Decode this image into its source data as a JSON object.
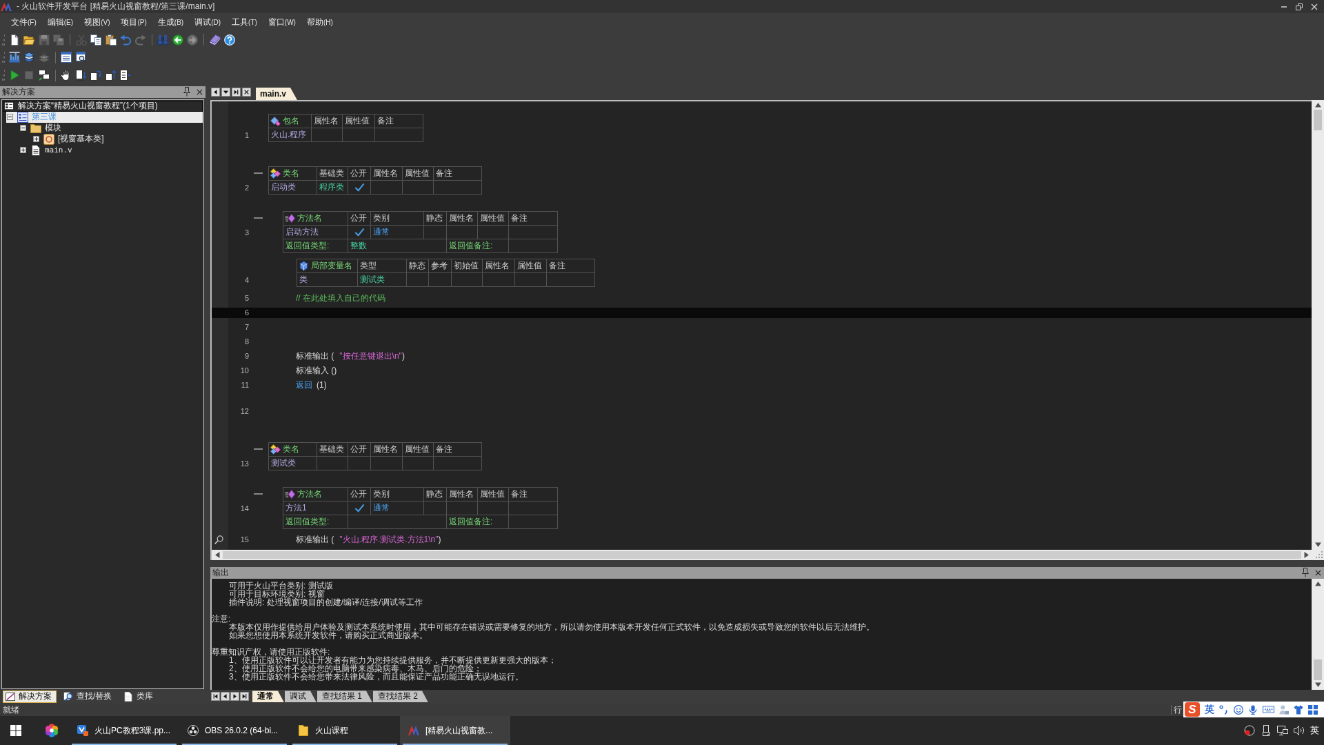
{
  "window": {
    "title": "- 火山软件开发平台 [精易火山视窗教程/第三课/main.v]"
  },
  "menu": [
    {
      "label": "文件",
      "key": "(F)"
    },
    {
      "label": "编辑",
      "key": "(E)"
    },
    {
      "label": "视图",
      "key": "(V)"
    },
    {
      "label": "项目",
      "key": "(P)"
    },
    {
      "label": "生成",
      "key": "(B)"
    },
    {
      "label": "调试",
      "key": "(D)"
    },
    {
      "label": "工具",
      "key": "(T)"
    },
    {
      "label": "窗口",
      "key": "(W)"
    },
    {
      "label": "帮助",
      "key": "(H)"
    }
  ],
  "toolbars": [
    {
      "groups": [
        [
          {
            "kind": "new",
            "disabled": false
          },
          {
            "kind": "open",
            "disabled": false
          },
          {
            "kind": "save",
            "disabled": true
          },
          {
            "kind": "save-all",
            "disabled": true
          }
        ],
        [
          {
            "kind": "cut",
            "disabled": true
          },
          {
            "kind": "copy",
            "disabled": false
          },
          {
            "kind": "paste",
            "disabled": false
          },
          {
            "kind": "undo",
            "disabled": false
          },
          {
            "kind": "redo",
            "disabled": true
          }
        ],
        [
          {
            "kind": "find",
            "disabled": false
          },
          {
            "kind": "back",
            "disabled": false
          },
          {
            "kind": "forward",
            "disabled": true
          }
        ],
        [
          {
            "kind": "book",
            "disabled": false
          },
          {
            "kind": "help",
            "disabled": false
          }
        ]
      ]
    },
    {
      "groups": [
        [
          {
            "kind": "build",
            "disabled": false
          },
          {
            "kind": "build-all",
            "disabled": false
          },
          {
            "kind": "clean",
            "disabled": true
          }
        ],
        [
          {
            "kind": "list",
            "disabled": false
          },
          {
            "kind": "preview",
            "disabled": false
          }
        ]
      ]
    },
    {
      "groups": [
        [
          {
            "kind": "run",
            "disabled": false
          },
          {
            "kind": "stop",
            "disabled": true
          },
          {
            "kind": "attach",
            "disabled": false
          }
        ],
        [
          {
            "kind": "hand",
            "disabled": false
          },
          {
            "kind": "step-into",
            "disabled": false
          },
          {
            "kind": "step-over",
            "disabled": false
          },
          {
            "kind": "step-out",
            "disabled": false
          },
          {
            "kind": "run-to",
            "disabled": false
          }
        ]
      ]
    }
  ],
  "solution_panel": {
    "title": "解决方案",
    "root": {
      "label": "解决方案“精易火山视窗教程”(1个项目)",
      "selected": false,
      "children": [
        {
          "label": "第三课",
          "kind": "project",
          "expanded": true,
          "selected": true,
          "children": [
            {
              "label": "模块",
              "kind": "folder",
              "expanded": true,
              "selected": false,
              "children": [
                {
                  "label": "[视窗基本类]",
                  "kind": "class",
                  "expanded": false,
                  "selected": false
                }
              ]
            },
            {
              "label": "main.v",
              "kind": "file",
              "expanded": false,
              "selected": false
            }
          ]
        }
      ]
    },
    "tabs": [
      {
        "label": "解决方案",
        "kind": "solution",
        "selected": true
      },
      {
        "label": "查找/替换",
        "kind": "find",
        "selected": false
      },
      {
        "label": "类库",
        "kind": "library",
        "selected": false
      }
    ]
  },
  "editor": {
    "tabs": [
      {
        "label": "main.v",
        "selected": true
      }
    ],
    "lines": [
      {
        "kind": "package",
        "number": "1",
        "header": [
          "包名",
          "属性名",
          "属性值",
          "备注"
        ],
        "rows": [
          {
            "kind": "main",
            "cells": [
              {
                "kind": "name",
                "text": "火山.程序"
              },
              {
                "kind": "empty"
              },
              {
                "kind": "empty"
              },
              {
                "kind": "empty"
              }
            ]
          }
        ]
      },
      {
        "kind": "class",
        "number": "2",
        "expanded": true,
        "header": [
          "类名",
          "基础类",
          "公开",
          "属性名",
          "属性值",
          "备注"
        ],
        "rows": [
          {
            "kind": "main",
            "cells": [
              {
                "kind": "name",
                "text": "启动类"
              },
              {
                "kind": "type",
                "text": "程序类"
              },
              {
                "kind": "check",
                "checked": true
              },
              {
                "kind": "empty"
              },
              {
                "kind": "empty"
              },
              {
                "kind": "empty"
              }
            ]
          }
        ]
      },
      {
        "kind": "method",
        "number": "3",
        "expanded": true,
        "header": [
          "方法名",
          "公开",
          "类别",
          "静态",
          "属性名",
          "属性值",
          "备注"
        ],
        "rows": [
          {
            "kind": "main",
            "cells": [
              {
                "kind": "name",
                "text": "启动方法"
              },
              {
                "kind": "check",
                "checked": true
              },
              {
                "kind": "keyword",
                "text": "通常"
              },
              {
                "kind": "check",
                "checked": false
              },
              {
                "kind": "empty"
              },
              {
                "kind": "empty"
              },
              {
                "kind": "empty"
              }
            ]
          },
          {
            "kind": "return",
            "cells": [
              {
                "kind": "label",
                "text": "返回值类型:"
              },
              {
                "kind": "type",
                "text": "整数"
              },
              {
                "kind": "label",
                "text": "返回值备注:"
              },
              {
                "kind": "empty"
              }
            ]
          }
        ]
      },
      {
        "kind": "locals",
        "number": "4",
        "header": [
          "局部变量名",
          "类型",
          "静态",
          "参考",
          "初始值",
          "属性名",
          "属性值",
          "备注"
        ],
        "rows": [
          {
            "kind": "main",
            "cells": [
              {
                "kind": "name",
                "text": "类"
              },
              {
                "kind": "type",
                "text": "测试类"
              },
              {
                "kind": "check",
                "checked": false
              },
              {
                "kind": "check",
                "checked": false
              },
              {
                "kind": "empty"
              },
              {
                "kind": "empty"
              },
              {
                "kind": "empty"
              },
              {
                "kind": "empty"
              }
            ]
          }
        ]
      },
      {
        "kind": "code",
        "number": "5",
        "current": false,
        "marked": false,
        "tokens": [
          {
            "kind": "comment",
            "text": "// 在此处填入自己的代码"
          }
        ]
      },
      {
        "kind": "blank",
        "number": "6",
        "current": true,
        "marked": false
      },
      {
        "kind": "blank",
        "number": "7",
        "current": false,
        "marked": false
      },
      {
        "kind": "blank",
        "number": "8",
        "current": false,
        "marked": false
      },
      {
        "kind": "code",
        "number": "9",
        "current": false,
        "marked": false,
        "tokens": [
          {
            "kind": "plain",
            "text": "标准输出 ("
          },
          {
            "kind": "string",
            "text": "\"按任意键退出\\n\""
          },
          {
            "kind": "plain",
            "text": ")"
          }
        ]
      },
      {
        "kind": "code",
        "number": "10",
        "current": false,
        "marked": false,
        "tokens": [
          {
            "kind": "plain",
            "text": "标准输入 ()"
          }
        ]
      },
      {
        "kind": "code",
        "number": "11",
        "current": false,
        "marked": false,
        "tokens": [
          {
            "kind": "keyword",
            "text": "返回"
          },
          {
            "kind": "plain",
            "text": "(1)"
          }
        ]
      },
      {
        "kind": "end",
        "number": "12",
        "current": false,
        "marked": false
      },
      {
        "kind": "class",
        "number": "13",
        "expanded": true,
        "header": [
          "类名",
          "基础类",
          "公开",
          "属性名",
          "属性值",
          "备注"
        ],
        "rows": [
          {
            "kind": "main",
            "cells": [
              {
                "kind": "name",
                "text": "测试类"
              },
              {
                "kind": "empty"
              },
              {
                "kind": "check",
                "checked": false
              },
              {
                "kind": "empty"
              },
              {
                "kind": "empty"
              },
              {
                "kind": "empty"
              }
            ]
          }
        ]
      },
      {
        "kind": "method",
        "number": "14",
        "expanded": true,
        "header": [
          "方法名",
          "公开",
          "类别",
          "静态",
          "属性名",
          "属性值",
          "备注"
        ],
        "rows": [
          {
            "kind": "main",
            "cells": [
              {
                "kind": "name",
                "text": "方法1"
              },
              {
                "kind": "check",
                "checked": true
              },
              {
                "kind": "keyword",
                "text": "通常"
              },
              {
                "kind": "check",
                "checked": false
              },
              {
                "kind": "empty"
              },
              {
                "kind": "empty"
              },
              {
                "kind": "empty"
              }
            ]
          },
          {
            "kind": "return",
            "cells": [
              {
                "kind": "label",
                "text": "返回值类型:"
              },
              {
                "kind": "empty"
              },
              {
                "kind": "label",
                "text": "返回值备注:"
              },
              {
                "kind": "empty"
              }
            ]
          }
        ]
      },
      {
        "kind": "code",
        "number": "15",
        "current": false,
        "marked": true,
        "tokens": [
          {
            "kind": "plain",
            "text": "标准输出 ("
          },
          {
            "kind": "string",
            "text": "\"火山.程序.测试类.方法1\\n\""
          },
          {
            "kind": "plain",
            "text": ")"
          }
        ]
      }
    ]
  },
  "output": {
    "title": "输出",
    "blocks": [
      {
        "lines": [
          "可用于火山平台类别: 测试版",
          "可用于目标环境类别: 视窗",
          "插件说明: 处理视窗项目的创建/编译/连接/调试等工作"
        ]
      },
      {
        "heading": "注意:",
        "lines": [
          "本版本仅用作提供给用户体验及测试本系统时使用，其中可能存在错误或需要修复的地方，所以请勿使用本版本开发任何正式软件，以免造成损失或导致您的软件以后无法维护。",
          "如果您想使用本系统开发软件，请购买正式商业版本。"
        ]
      },
      {
        "heading": "尊重知识产权，请使用正版软件:",
        "lines": [
          "1、使用正版软件可以让开发者有能力为您持续提供服务，并不断提供更新更强大的版本；",
          "2、使用正版软件不会给您的电脑带来感染病毒、木马、后门的危险；",
          "3、使用正版软件不会给您带来法律风险，而且能保证产品功能正确无误地运行。"
        ]
      }
    ],
    "tabs": [
      {
        "label": "通常",
        "selected": true
      },
      {
        "label": "调试",
        "selected": false
      },
      {
        "label": "查找结果 1",
        "selected": false
      },
      {
        "label": "查找结果 2",
        "selected": false
      }
    ]
  },
  "status_bar": {
    "message": "就绪",
    "position_label": "行"
  },
  "ime_toolbar": {
    "logo": "S",
    "mode": "英"
  },
  "taskbar": {
    "apps": [
      {
        "label": "火山PC教程3课.pp...",
        "kind": "presentation",
        "active": false
      },
      {
        "label": "OBS 26.0.2 (64-bi...",
        "kind": "obs",
        "active": false
      },
      {
        "label": "火山课程",
        "kind": "folder",
        "active": false
      },
      {
        "label": "[精易火山视窗教...",
        "kind": "ide",
        "active": true
      }
    ],
    "language": "英"
  }
}
